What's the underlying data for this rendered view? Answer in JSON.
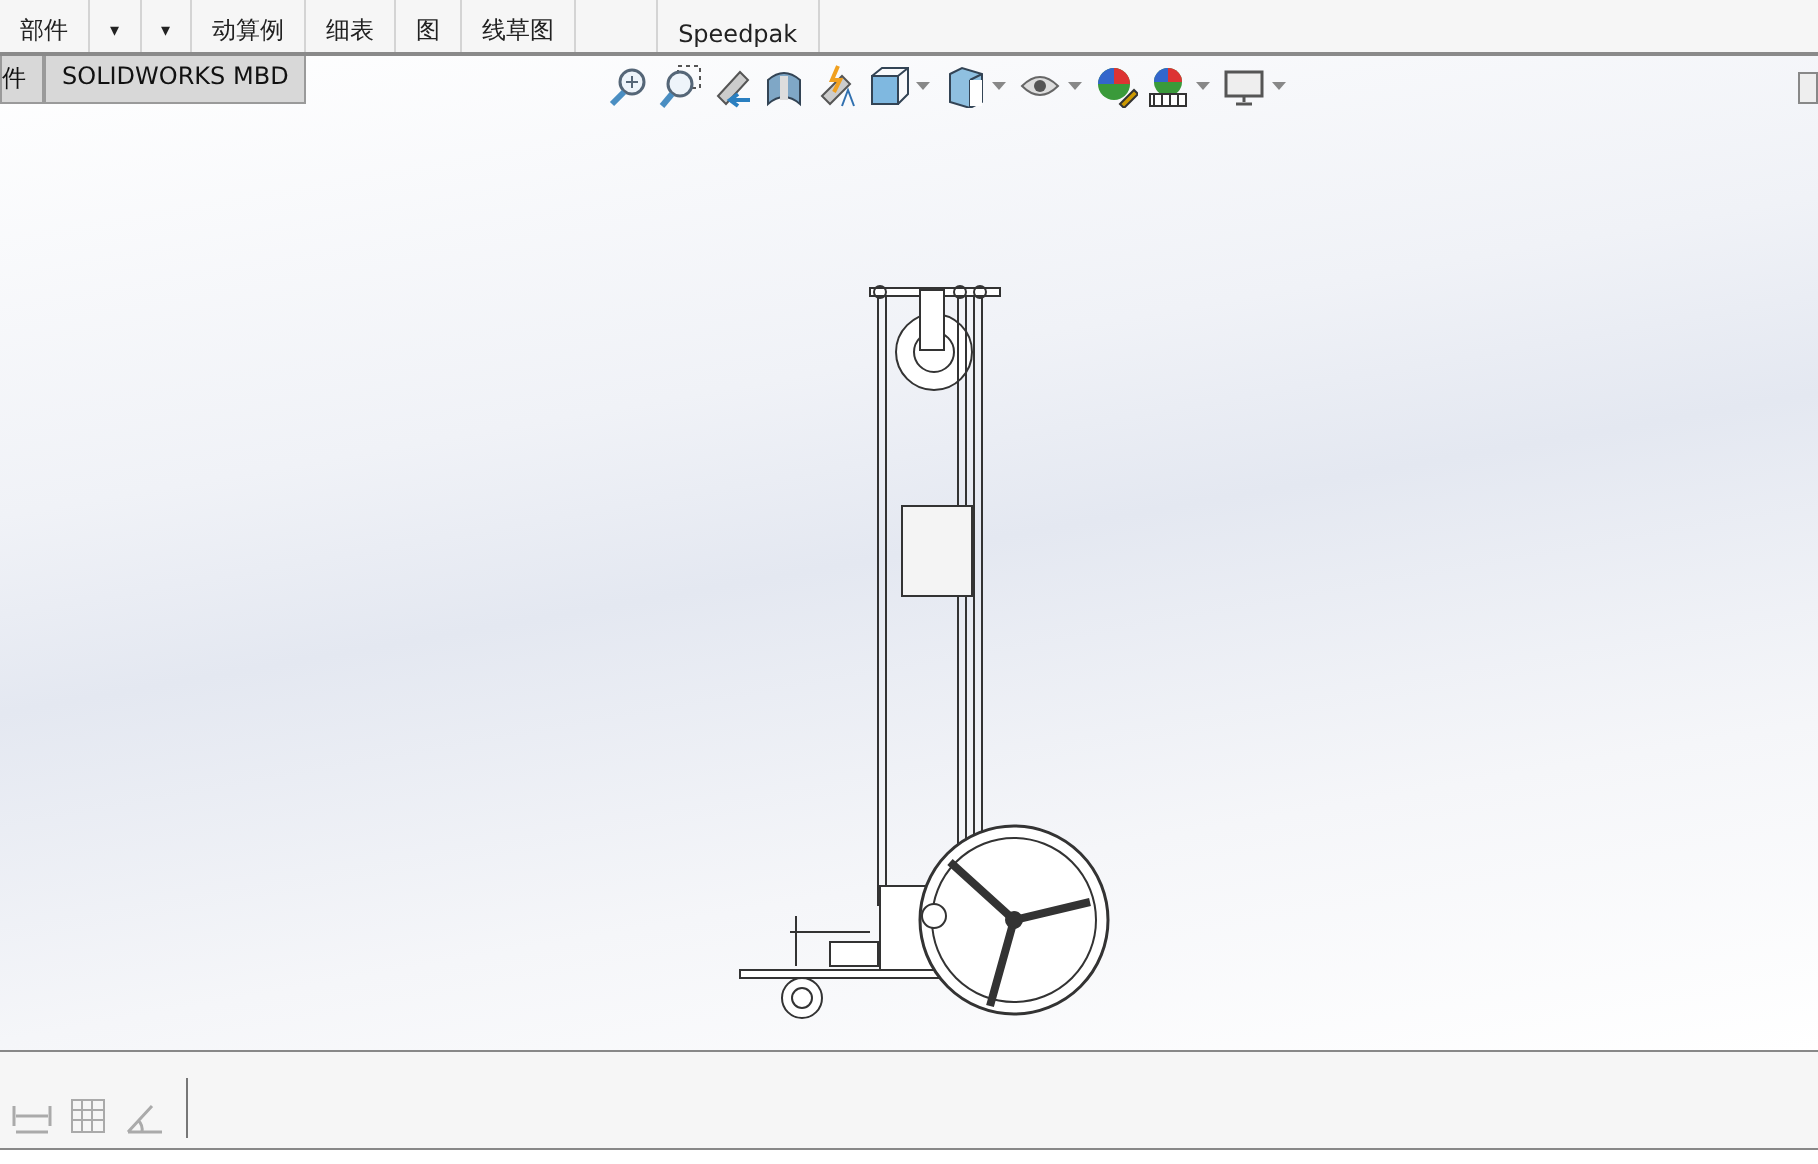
{
  "ribbon": {
    "groups": [
      {
        "kind": "label",
        "text": "部件"
      },
      {
        "kind": "caret",
        "text": "▾"
      },
      {
        "kind": "caret",
        "text": "▾"
      },
      {
        "kind": "label",
        "text": "动算例"
      },
      {
        "kind": "label",
        "text": "细表"
      },
      {
        "kind": "label",
        "text": "图"
      },
      {
        "kind": "label",
        "text": "线草图"
      },
      {
        "kind": "blank"
      },
      {
        "kind": "label",
        "text": "Speedpak"
      }
    ]
  },
  "tabs": [
    {
      "label": "件",
      "selected": false
    },
    {
      "label": "SOLIDWORKS MBD",
      "selected": false
    }
  ],
  "view_toolbar": [
    {
      "kind": "zoom-fit",
      "has_menu": false
    },
    {
      "kind": "zoom-area",
      "has_menu": false
    },
    {
      "kind": "previous-view",
      "has_menu": false
    },
    {
      "kind": "section",
      "has_menu": false
    },
    {
      "kind": "dynamic",
      "has_menu": false
    },
    {
      "kind": "orientation",
      "has_menu": true
    },
    {
      "kind": "display-style",
      "has_menu": true
    },
    {
      "kind": "hide-show",
      "has_menu": true
    },
    {
      "kind": "edit-appearance",
      "has_menu": false
    },
    {
      "kind": "scene",
      "has_menu": true
    },
    {
      "kind": "display",
      "has_menu": true
    }
  ],
  "sketch_tools": [
    {
      "kind": "dimension"
    },
    {
      "kind": "grid"
    },
    {
      "kind": "angle"
    }
  ]
}
